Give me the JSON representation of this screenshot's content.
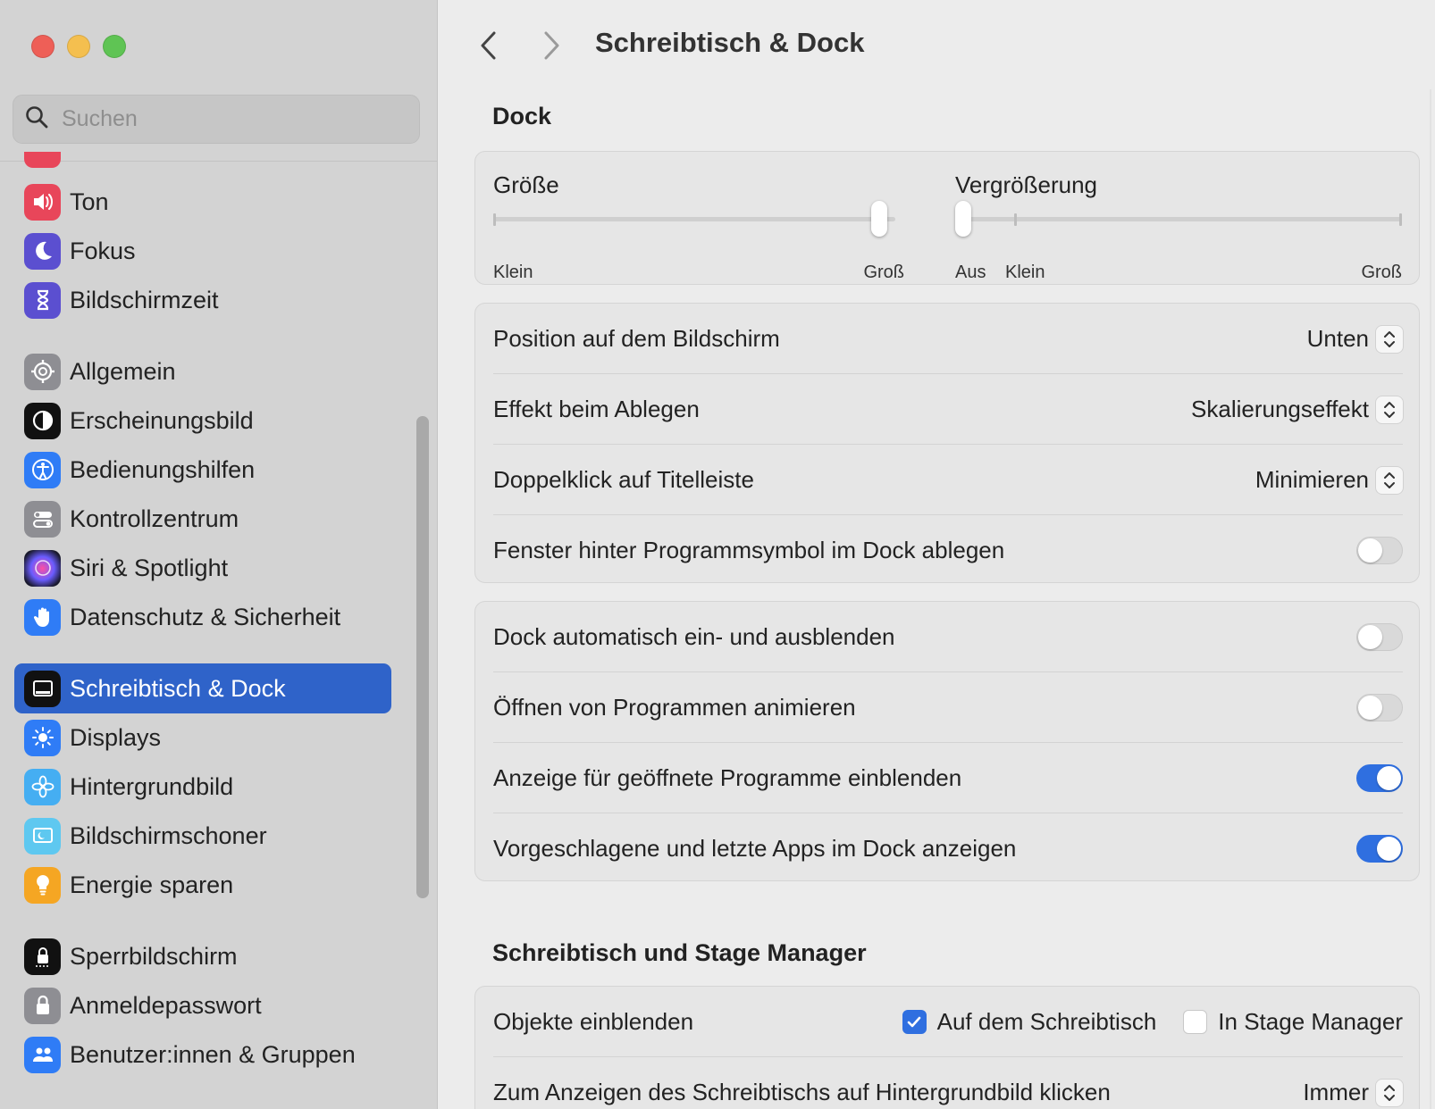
{
  "sidebar": {
    "search_placeholder": "Suchen",
    "items": [
      {
        "label": "Ton",
        "icon": "speaker-icon",
        "color": "#e8465a"
      },
      {
        "label": "Fokus",
        "icon": "moon-icon",
        "color": "#5b4fd0"
      },
      {
        "label": "Bildschirmzeit",
        "icon": "hourglass-icon",
        "color": "#5b4fd0"
      },
      {
        "label": "Allgemein",
        "icon": "gear-icon",
        "color": "#8e8e93"
      },
      {
        "label": "Erscheinungsbild",
        "icon": "appearance-icon",
        "color": "#111111"
      },
      {
        "label": "Bedienungshilfen",
        "icon": "accessibility-icon",
        "color": "#2f7cf6"
      },
      {
        "label": "Kontrollzentrum",
        "icon": "toggles-icon",
        "color": "#8e8e93"
      },
      {
        "label": "Siri & Spotlight",
        "icon": "siri-icon",
        "color": "#3b3b6b"
      },
      {
        "label": "Datenschutz & Sicherheit",
        "icon": "hand-icon",
        "color": "#2f7cf6"
      },
      {
        "label": "Schreibtisch & Dock",
        "icon": "dock-icon",
        "color": "#111111",
        "selected": true
      },
      {
        "label": "Displays",
        "icon": "sun-icon",
        "color": "#2f7cf6"
      },
      {
        "label": "Hintergrundbild",
        "icon": "flower-icon",
        "color": "#45aef2"
      },
      {
        "label": "Bildschirmschoner",
        "icon": "screensaver-icon",
        "color": "#5ec8f0"
      },
      {
        "label": "Energie sparen",
        "icon": "lightbulb-icon",
        "color": "#f5a623"
      },
      {
        "label": "Sperrbildschirm",
        "icon": "lock-screen-icon",
        "color": "#111111"
      },
      {
        "label": "Anmeldepasswort",
        "icon": "padlock-icon",
        "color": "#8e8e93"
      },
      {
        "label": "Benutzer:innen & Gruppen",
        "icon": "users-icon",
        "color": "#2f7cf6"
      }
    ]
  },
  "header": {
    "title": "Schreibtisch & Dock"
  },
  "dock": {
    "section_title": "Dock",
    "size": {
      "label": "Größe",
      "min_label": "Klein",
      "max_label": "Groß",
      "value": 0.96
    },
    "magnification": {
      "label": "Vergrößerung",
      "off_label": "Aus",
      "min_label": "Klein",
      "max_label": "Groß",
      "value": 0.0
    },
    "settings": [
      {
        "label": "Position auf dem Bildschirm",
        "value": "Unten"
      },
      {
        "label": "Effekt beim Ablegen",
        "value": "Skalierungseffekt"
      },
      {
        "label": "Doppelklick auf Titelleiste",
        "value": "Minimieren"
      },
      {
        "label": "Fenster hinter Programmsymbol im Dock ablegen",
        "on": false
      }
    ],
    "toggles": [
      {
        "label": "Dock automatisch ein- und ausblenden",
        "on": false
      },
      {
        "label": "Öffnen von Programmen animieren",
        "on": false
      },
      {
        "label": "Anzeige für geöffnete Programme einblenden",
        "on": true
      },
      {
        "label": "Vorgeschlagene und letzte Apps im Dock anzeigen",
        "on": true
      }
    ]
  },
  "stage": {
    "section_title": "Schreibtisch und Stage Manager",
    "show_items_label": "Objekte einblenden",
    "on_desktop_label": "Auf dem Schreibtisch",
    "on_desktop_checked": true,
    "in_stage_manager_label": "In Stage Manager",
    "in_stage_manager_checked": false,
    "click_wallpaper_label": "Zum Anzeigen des Schreibtischs auf Hintergrundbild klicken",
    "click_wallpaper_value": "Immer"
  },
  "colors": {
    "accent": "#2f6fe0",
    "sidebar_selected": "#2f63c9",
    "close": "#ee5f57",
    "minimize": "#f4bf4f",
    "zoom": "#5fc454"
  }
}
